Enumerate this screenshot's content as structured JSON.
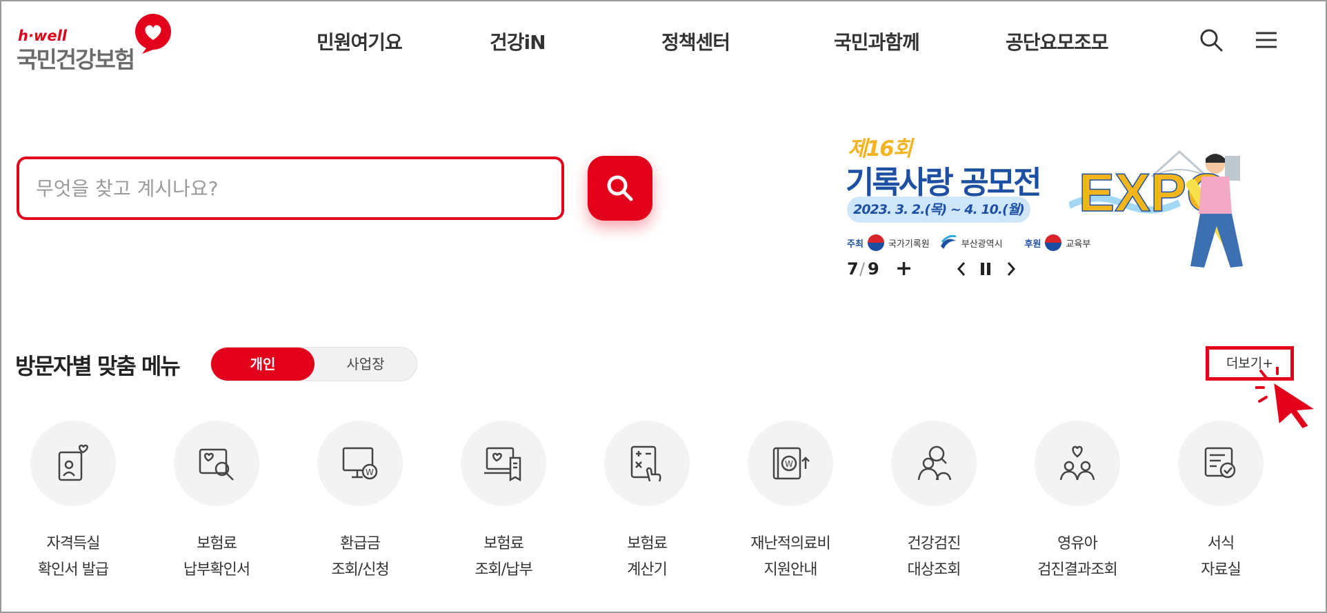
{
  "brand": {
    "en": "h·well",
    "ko": "국민건강보험",
    "accent": "#e3001b"
  },
  "gnb": [
    {
      "label": "민원여기요"
    },
    {
      "label": "건강iN"
    },
    {
      "label": "정책센터"
    },
    {
      "label": "국민과함께"
    },
    {
      "label": "공단요모조모"
    }
  ],
  "header_icons": {
    "search": "search-icon",
    "menu": "hamburger-menu-icon"
  },
  "search": {
    "placeholder": "무엇을 찾고 계시나요?",
    "value": ""
  },
  "banner": {
    "edition": "제16회",
    "title": "기록사랑 공모전",
    "date": "2023. 3. 2.(목) ~ 4. 10.(월)",
    "host_label": "주최",
    "host_1": "국가기록원",
    "host_2": "부산광역시",
    "sponsor_label": "후원",
    "sponsor": "교육부",
    "expo": "EXPO",
    "current": "7",
    "total": "9",
    "plus": "+"
  },
  "persona": {
    "title": "방문자별 맞춤 메뉴",
    "tabs": [
      "개인",
      "사업장"
    ],
    "active_tab": "개인",
    "more": "더보기+"
  },
  "menu": [
    {
      "line1": "자격득실",
      "line2": "확인서 발급",
      "icon": "id-card-heart-icon"
    },
    {
      "line1": "보험료",
      "line2": "납부확인서",
      "icon": "document-search-icon"
    },
    {
      "line1": "환급금",
      "line2": "조회/신청",
      "icon": "monitor-won-icon"
    },
    {
      "line1": "보험료",
      "line2": "조회/납부",
      "icon": "laptop-receipt-icon"
    },
    {
      "line1": "보험료",
      "line2": "계산기",
      "icon": "calculator-touch-icon"
    },
    {
      "line1": "재난적의료비",
      "line2": "지원안내",
      "icon": "book-won-up-icon"
    },
    {
      "line1": "건강검진",
      "line2": "대상조회",
      "icon": "people-search-icon"
    },
    {
      "line1": "영유아",
      "line2": "검진결과조회",
      "icon": "family-heart-icon"
    },
    {
      "line1": "서식",
      "line2": "자료실",
      "icon": "form-check-icon"
    }
  ]
}
